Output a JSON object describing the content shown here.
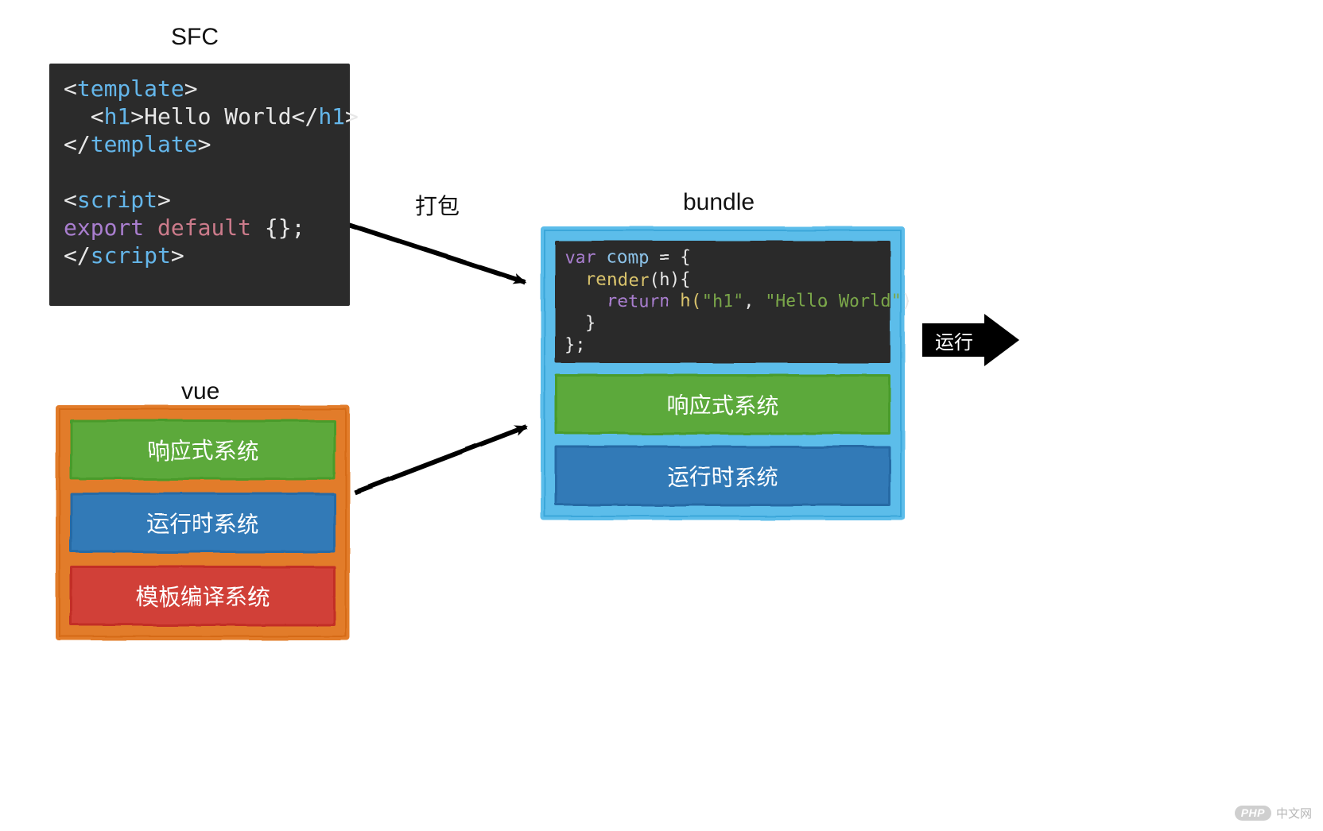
{
  "titles": {
    "sfc": "SFC",
    "vue": "vue",
    "bundle": "bundle"
  },
  "labels": {
    "package": "打包",
    "run": "运行"
  },
  "sfc_code": {
    "template_open": "template",
    "h1_open": "h1",
    "h1_text": "Hello World",
    "h1_close": "h1",
    "template_close": "template",
    "script_open": "script",
    "export_kw": "export",
    "default_kw": "default",
    "export_rest": " {};",
    "script_close": "script"
  },
  "bundle_code": {
    "var_kw": "var",
    "var_name": " comp ",
    "eq": "= {",
    "render_fn": "render",
    "render_args": "(h){",
    "return_kw": "return",
    "h_call_open": " h(",
    "str1": "\"h1\"",
    "sep": ", ",
    "str2": "\"Hello World\"",
    "h_call_close": ")",
    "close_brace1": "  }",
    "close_brace2": "};"
  },
  "vue_box": {
    "reactive": "响应式系统",
    "runtime": "运行时系统",
    "compiler": "模板编译系统"
  },
  "bundle_box": {
    "reactive": "响应式系统",
    "runtime": "运行时系统"
  },
  "watermark": {
    "php": "PHP",
    "text": "中文网"
  }
}
